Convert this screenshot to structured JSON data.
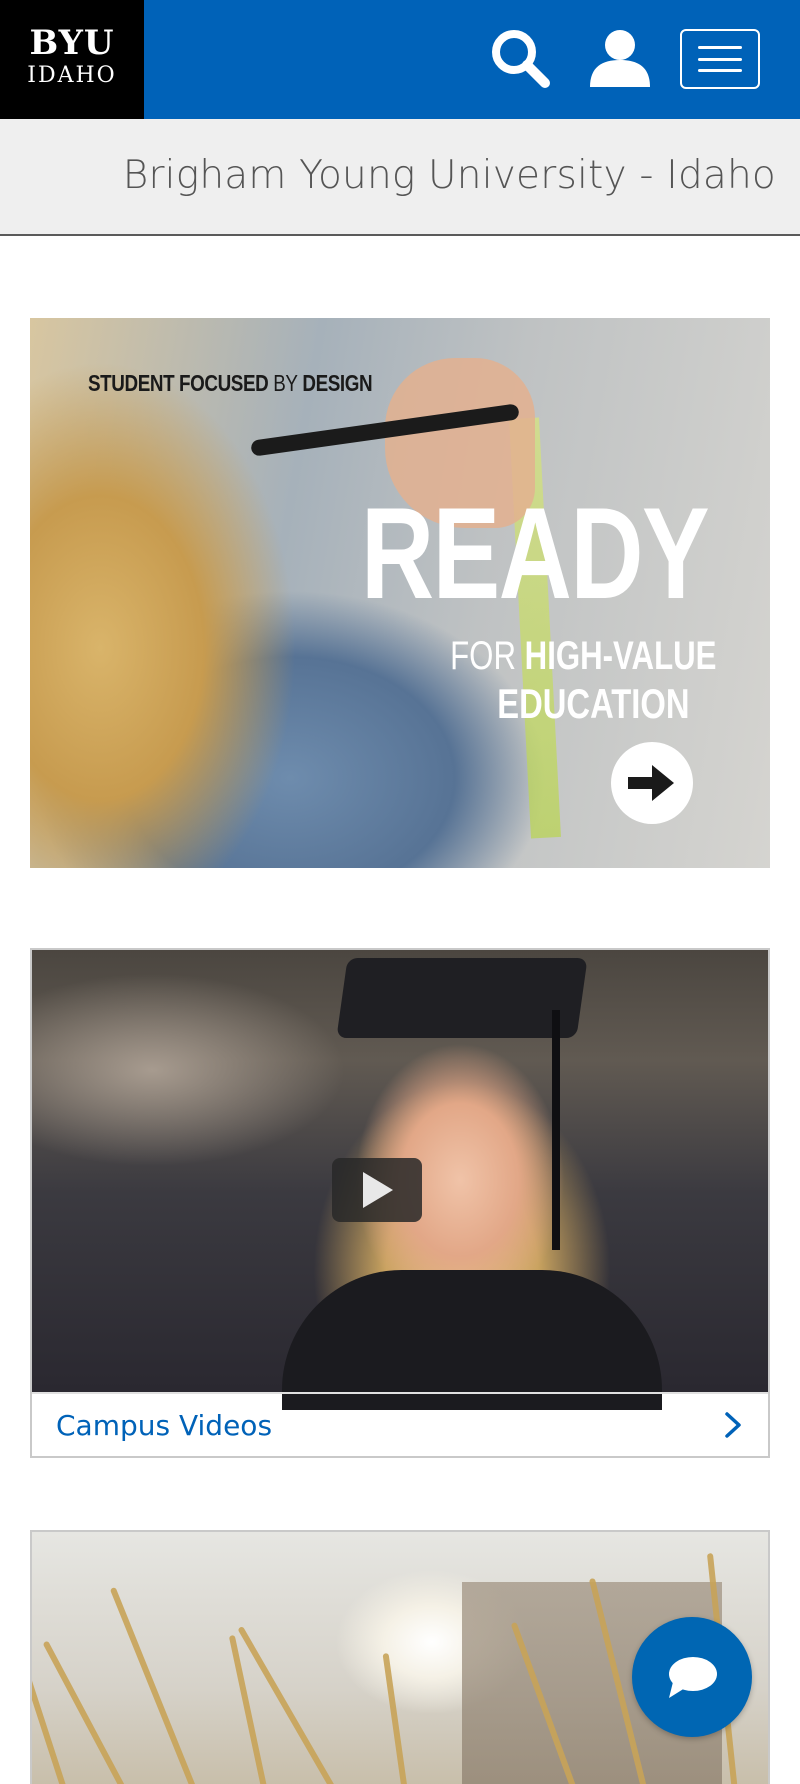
{
  "header": {
    "logo": {
      "line1": "BYU",
      "line2": "IDAHO"
    },
    "search_icon": "search-icon",
    "user_icon": "user-icon",
    "menu_icon": "hamburger-menu-icon",
    "brand_color": "#0062b8"
  },
  "title_band": {
    "title": "Brigham Young University - Idaho"
  },
  "hero": {
    "kicker_bold_1": "STUDENT FOCUSED",
    "kicker_light": "BY",
    "kicker_bold_2": "DESIGN",
    "headline": "READY",
    "sub_light": "FOR",
    "sub_bold": "HIGH-VALUE",
    "sub_line2": "EDUCATION",
    "arrow_icon": "arrow-right-circle-icon"
  },
  "video_card": {
    "play_icon": "play-icon",
    "label": "Campus Videos",
    "chevron_icon": "chevron-right-icon"
  },
  "chat": {
    "icon": "chat-bubble-icon",
    "color": "#0066b3"
  }
}
